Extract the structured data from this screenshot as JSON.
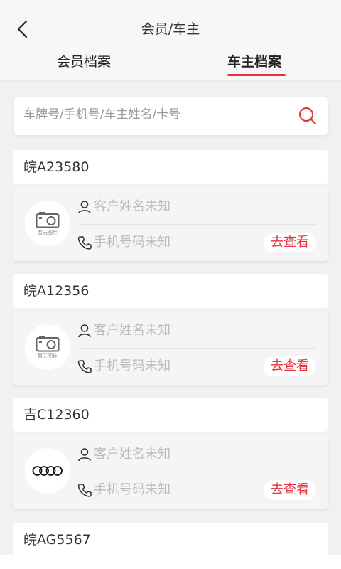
{
  "header": {
    "title": "会员/车主"
  },
  "tabs": [
    {
      "label": "会员档案",
      "active": false
    },
    {
      "label": "车主档案",
      "active": true
    }
  ],
  "search": {
    "placeholder": "车牌号/手机号/车主姓名/卡号"
  },
  "colors": {
    "accent": "#e8323c",
    "placeholder": "#bbbbbb",
    "background": "#f1f1f1"
  },
  "records": [
    {
      "plate": "皖A23580",
      "avatar": "no-image-camera-icon",
      "avatar_caption": "暂无图片",
      "name": "客户姓名未知",
      "phone": "手机号码未知",
      "action": "去查看"
    },
    {
      "plate": "皖A12356",
      "avatar": "no-image-camera-icon",
      "avatar_caption": "暂无图片",
      "name": "客户姓名未知",
      "phone": "手机号码未知",
      "action": "去查看"
    },
    {
      "plate": "吉C12360",
      "avatar": "audi-rings-logo",
      "avatar_caption": "",
      "name": "客户姓名未知",
      "phone": "手机号码未知",
      "action": "去查看"
    },
    {
      "plate": "皖AG5567"
    }
  ]
}
